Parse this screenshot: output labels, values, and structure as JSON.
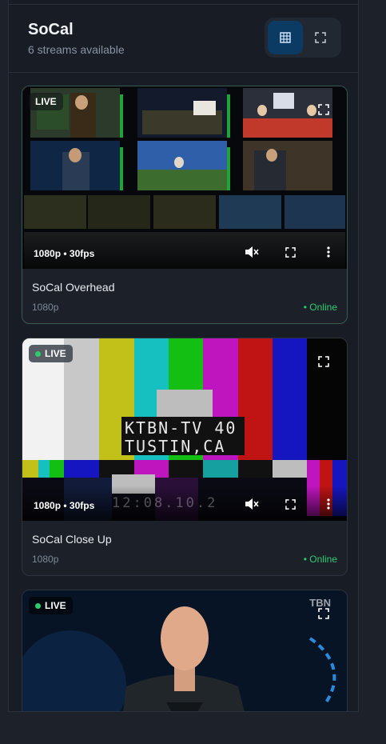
{
  "header": {
    "title": "SoCal",
    "subtitle": "6 streams available",
    "view_grid_icon": "grid-icon",
    "view_full_icon": "fullscreen-icon"
  },
  "streams": [
    {
      "name": "SoCal Overhead",
      "resolution": "1080p",
      "status": "• Online",
      "live_label": "LIVE",
      "quality_label": "1080p • 30fps"
    },
    {
      "name": "SoCal Close Up",
      "resolution": "1080p",
      "status": "• Online",
      "live_label": "LIVE",
      "quality_label": "1080p • 30fps",
      "slate_line1": "KTBN-TV 40",
      "slate_line2": "TUSTIN,CA",
      "timecode": "12:08.10.2"
    },
    {
      "live_label": "LIVE",
      "watermark": "TBN"
    }
  ],
  "colors": {
    "accent": "#0b3a63",
    "online": "#2ecc71",
    "background": "#181c24"
  }
}
